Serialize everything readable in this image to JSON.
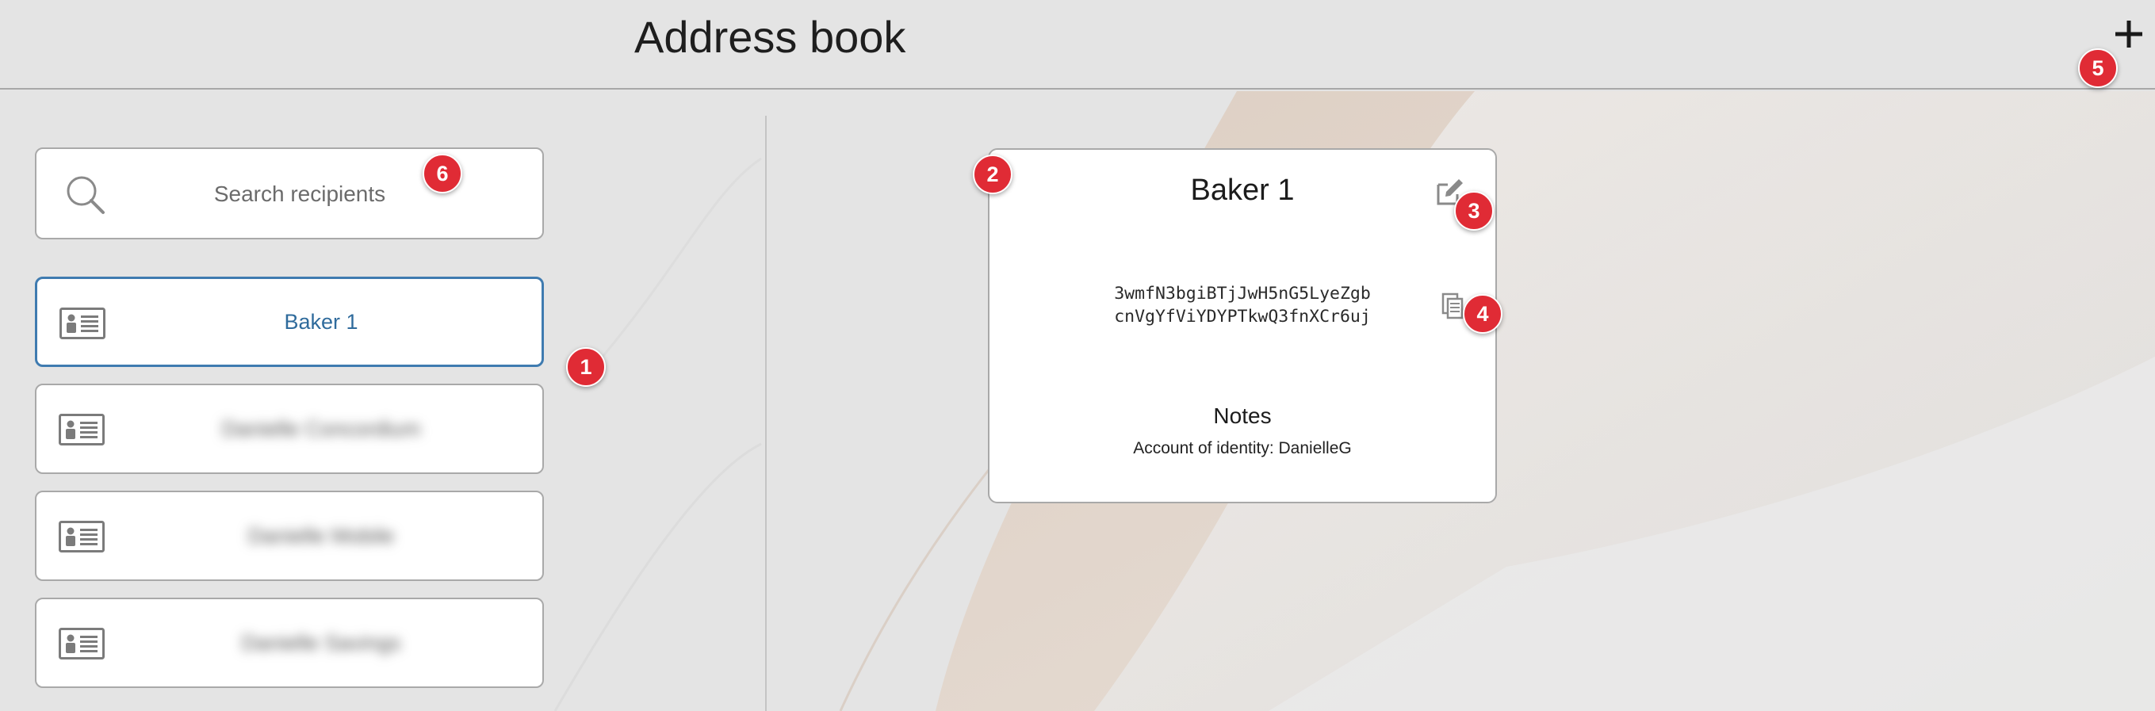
{
  "header": {
    "title": "Address book",
    "add_icon": "plus-icon"
  },
  "search": {
    "placeholder": "Search recipients",
    "icon": "search-icon"
  },
  "recipients": [
    {
      "name": "Baker 1",
      "selected": true,
      "blurred": false,
      "icon": "contact-card-icon"
    },
    {
      "name": "Danielle Concordium",
      "selected": false,
      "blurred": true,
      "icon": "contact-card-icon"
    },
    {
      "name": "Danielle Mobile",
      "selected": false,
      "blurred": true,
      "icon": "contact-card-icon"
    },
    {
      "name": "Danielle Savings",
      "selected": false,
      "blurred": true,
      "icon": "contact-card-icon"
    }
  ],
  "detail": {
    "name": "Baker 1",
    "address_line1": "3wmfN3bgiBTjJwH5nG5LyeZgb",
    "address_line2": "cnVgYfViYDYPTkwQ3fnXCr6uj",
    "notes_title": "Notes",
    "notes_text": "Account of identity: DanielleG",
    "edit_icon": "edit-icon",
    "copy_icon": "copy-icon"
  },
  "badges": [
    "1",
    "2",
    "3",
    "4",
    "5",
    "6"
  ],
  "colors": {
    "accent": "#3f7bb0",
    "badge": "#e02b35",
    "background": "#e4e4e4"
  }
}
